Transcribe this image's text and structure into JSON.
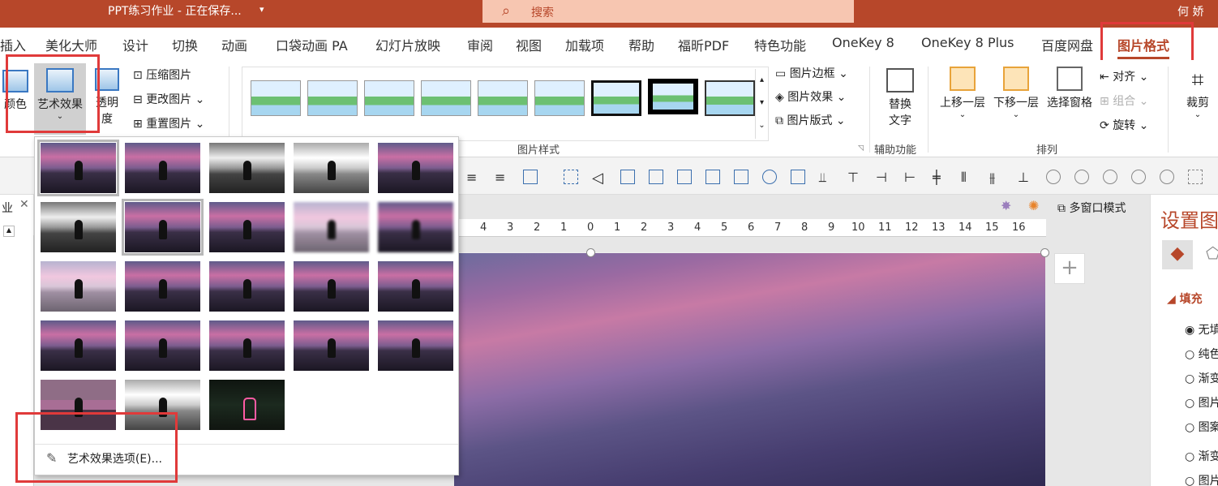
{
  "titlebar": {
    "doc_title": "PPT练习作业  -  正在保存...",
    "search_label": "搜索",
    "user": "何 娇"
  },
  "tabs": [
    "插入",
    "美化大师",
    "设计",
    "切换",
    "动画",
    "口袋动画 PA",
    "幻灯片放映",
    "审阅",
    "视图",
    "加载项",
    "帮助",
    "福昕PDF",
    "特色功能",
    "OneKey 8",
    "OneKey 8 Plus",
    "百度网盘",
    "图片格式"
  ],
  "ribbon": {
    "adjust": {
      "color": "颜色",
      "artistic": "艺术效果",
      "transparency_1": "透明",
      "transparency_2": "度",
      "compress": "压缩图片",
      "change": "更改图片",
      "reset": "重置图片"
    },
    "styles": {
      "group_label": "图片样式",
      "border": "图片边框",
      "effects": "图片效果",
      "layout": "图片版式"
    },
    "accessibility": {
      "alt_text_1": "替换",
      "alt_text_2": "文字",
      "group_label": "辅助功能"
    },
    "arrange": {
      "bring_forward": "上移一层",
      "send_backward": "下移一层",
      "selection_pane": "选择窗格",
      "align": "对齐",
      "group": "组合",
      "rotate": "旋转",
      "group_label": "排列"
    },
    "size": {
      "crop": "裁剪"
    }
  },
  "toolbar2": {
    "multiwindow": "多窗口模式"
  },
  "left_panel": {
    "label": "业"
  },
  "ruler_labels": [
    "4",
    "3",
    "2",
    "1",
    "0",
    "1",
    "2",
    "3",
    "4",
    "5",
    "6",
    "7",
    "8",
    "9",
    "10",
    "11",
    "12",
    "13",
    "14",
    "15",
    "16"
  ],
  "format_pane": {
    "title": "设置图",
    "fill_label": "填充",
    "options": [
      "无填",
      "纯色",
      "渐变",
      "图片",
      "图案",
      "渐变",
      "图片"
    ]
  },
  "dropdown": {
    "option_label": "艺术效果选项(E)..."
  },
  "colors": {
    "accent": "#b7472a",
    "highlight_box": "#e03a3a"
  }
}
